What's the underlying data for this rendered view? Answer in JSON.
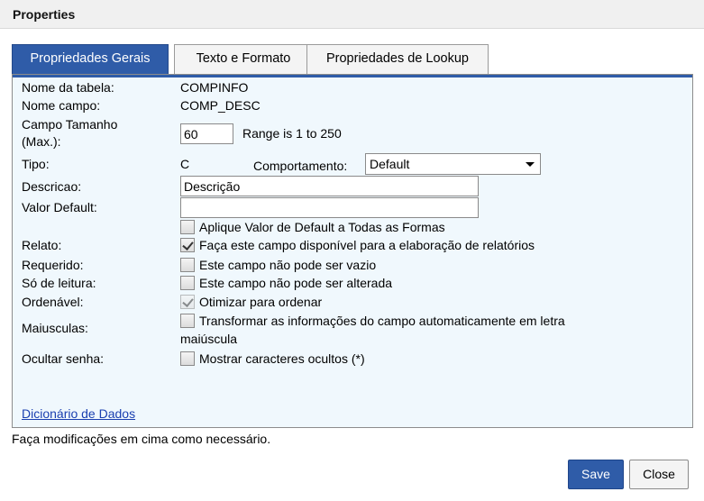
{
  "window": {
    "title": "Properties"
  },
  "tabs": [
    {
      "label": "Propriedades Gerais",
      "active": true
    },
    {
      "label": "Texto e Formato",
      "active": false
    },
    {
      "label": "Propriedades de Lookup",
      "active": false
    }
  ],
  "form": {
    "table_name_label": "Nome da tabela:",
    "table_name_value": "COMPINFO",
    "field_name_label": "Nome campo:",
    "field_name_value": "COMP_DESC",
    "size_label_line1": "Campo Tamanho",
    "size_label_line2": "(Max.):",
    "size_value": "60",
    "size_range": "Range is  1 to 250",
    "type_label": "Tipo:",
    "type_value": "C",
    "behavior_label": "Comportamento:",
    "behavior_value": "Default",
    "description_label": "Descricao:",
    "description_value": "Descrição",
    "default_label": "Valor Default:",
    "default_value": "",
    "apply_default_text": "Aplique Valor de Default a Todas as Formas",
    "apply_default_checked": false,
    "report_label": "Relato:",
    "report_text": "Faça este campo disponível para a elaboração de relatórios",
    "report_checked": true,
    "required_label": "Requerido:",
    "required_text": "Este campo não pode ser vazio",
    "required_checked": false,
    "readonly_label": "Só de leitura:",
    "readonly_text": "Este campo não pode ser alterada",
    "readonly_checked": false,
    "sortable_label": "Ordenável:",
    "sortable_text": "Otimizar para ordenar",
    "sortable_checked": true,
    "uppercase_label": "Maiusculas:",
    "uppercase_text_line1": "Transformar as informações do campo automaticamente em letra",
    "uppercase_text_line2": "maiúscula",
    "uppercase_checked": false,
    "hide_label": "Ocultar senha:",
    "hide_text": "Mostrar caracteres ocultos (*)",
    "hide_checked": false,
    "dictionary_link": "Dicionário de Dados"
  },
  "footer": {
    "hint": "Faça modificações em cima como necessário.",
    "save_label": "Save",
    "close_label": "Close"
  },
  "colors": {
    "accent": "#2f5ca8",
    "panel_bg": "#f0f8fd",
    "link": "#1a3fb0"
  }
}
